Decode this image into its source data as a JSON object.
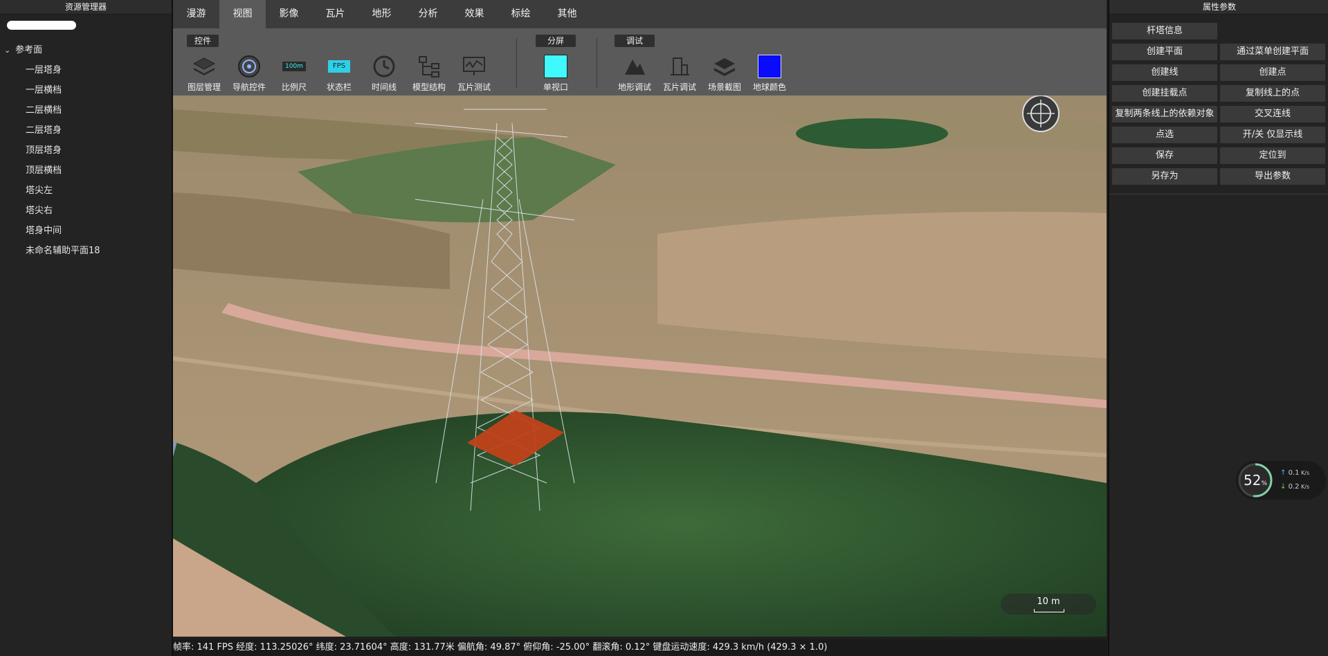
{
  "left_panel": {
    "title": "资源管理器",
    "tree": {
      "root_label": "参考面",
      "items": [
        "一层塔身",
        "一层横档",
        "二层横档",
        "二层塔身",
        "顶层塔身",
        "顶层横档",
        "塔尖左",
        "塔尖右",
        "塔身中间",
        "未命名辅助平面18"
      ]
    }
  },
  "toolbar": {
    "tabs": [
      "漫游",
      "视图",
      "影像",
      "瓦片",
      "地形",
      "分析",
      "效果",
      "标绘",
      "其他"
    ],
    "active_tab": "视图",
    "groups": {
      "controls": "控件",
      "split": "分屏",
      "debug": "调试"
    },
    "tools": {
      "layer_mgmt": "图层管理",
      "nav_control": "导航控件",
      "scale": "比例尺",
      "scale_icon_text": "100m",
      "status_bar": "状态栏",
      "fps_icon_text": "FPS",
      "timeline": "时间线",
      "model_structure": "模型结构",
      "tile_test": "瓦片测试",
      "single_view": "单视口",
      "terrain_debug": "地形调试",
      "tile_debug": "瓦片调试",
      "scene_capture": "场景截图",
      "globe_color": "地球颜色"
    },
    "colors": {
      "single_view": "#3ff9ff",
      "globe_color": "#0a0aff"
    }
  },
  "viewport": {
    "scale_label": "10 m"
  },
  "status_bar": {
    "text": "帧率: 141 FPS 经度: 113.25026° 纬度: 23.71604° 高度: 131.77米 偏航角: 49.87° 俯仰角: -25.00° 翻滚角: 0.12° 键盘运动速度: 429.3 km/h (429.3 × 1.0)"
  },
  "right_panel": {
    "title": "属性参数",
    "buttons": {
      "tower_info": "杆塔信息",
      "create_plane": "创建平面",
      "create_plane_menu": "通过菜单创建平面",
      "create_line": "创建线",
      "create_point": "创建点",
      "create_mount_point": "创建挂载点",
      "copy_line_points": "复制线上的点",
      "copy_dependency": "复制两条线上的依赖对象",
      "cross_connect": "交叉连线",
      "select_point": "点选",
      "toggle_line_only": "开/关 仅显示线",
      "save": "保存",
      "locate": "定位到",
      "save_as": "另存为",
      "export_params": "导出参数"
    },
    "perf": {
      "percent": "52",
      "unit": "%",
      "up": "0.1",
      "down": "0.2",
      "rate_unit": "K/s"
    }
  }
}
